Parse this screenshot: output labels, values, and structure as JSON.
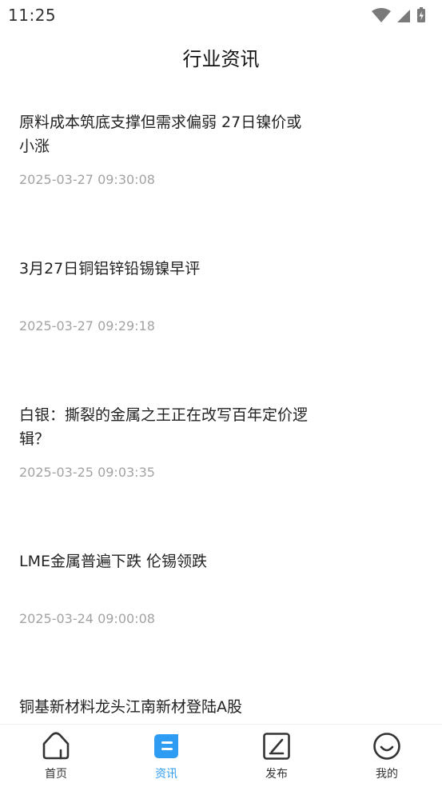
{
  "status_bar": {
    "time": "11:25"
  },
  "header": {
    "title": "行业资讯"
  },
  "news": [
    {
      "title": "原料成本筑底支撑但需求偏弱 27日镍价或小涨",
      "date": "2025-03-27 09:30:08"
    },
    {
      "title": "3月27日铜铝锌铅锡镍早评",
      "date": "2025-03-27 09:29:18"
    },
    {
      "title": "白银：撕裂的金属之王正在改写百年定价逻辑？",
      "date": "2025-03-25 09:03:35"
    },
    {
      "title": "LME金属普遍下跌 伦锡领跌",
      "date": "2025-03-24 09:00:08"
    },
    {
      "title": "铜基新材料龙头江南新材登陆A股",
      "date": ""
    }
  ],
  "tabbar": {
    "items": [
      {
        "label": "首页",
        "icon": "home-icon",
        "active": false
      },
      {
        "label": "资讯",
        "icon": "news-icon",
        "active": true
      },
      {
        "label": "发布",
        "icon": "publish-icon",
        "active": false
      },
      {
        "label": "我的",
        "icon": "profile-icon",
        "active": false
      }
    ],
    "active_color": "#2f9cf3"
  }
}
